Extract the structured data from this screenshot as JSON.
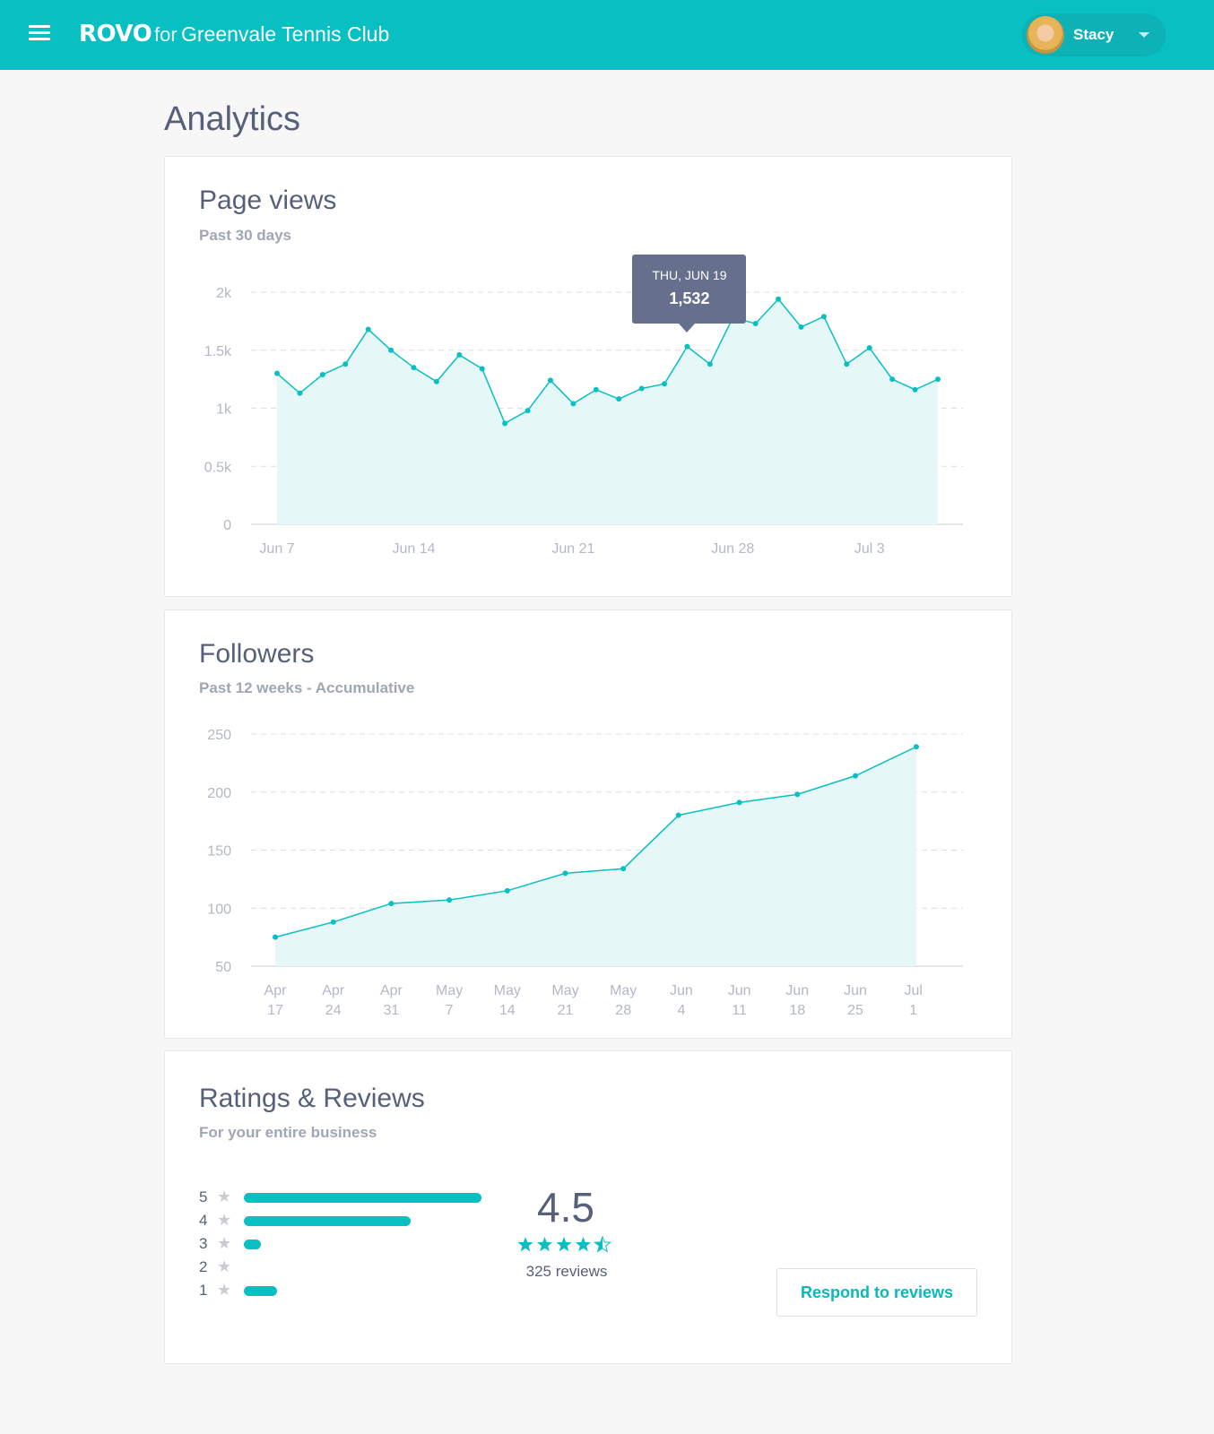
{
  "header": {
    "logo_text": "ROVO",
    "logo_for": "for",
    "organization": "Greenvale Tennis Club",
    "user_name": "Stacy",
    "menu_icon": "hamburger-menu-icon",
    "dropdown_icon": "chevron-down-icon"
  },
  "page": {
    "title": "Analytics"
  },
  "colors": {
    "accent": "#08bfc2",
    "area_fill": "#e5f7f7",
    "text": "#56607a",
    "tooltip_bg": "#66708c"
  },
  "page_views": {
    "title": "Page views",
    "subtitle": "Past 30 days",
    "tooltip": {
      "date": "THU, JUN 19",
      "value": "1,532"
    }
  },
  "followers": {
    "title": "Followers",
    "subtitle": "Past 12 weeks - Accumulative"
  },
  "reviews": {
    "title": "Ratings & Reviews",
    "subtitle": "For your entire business",
    "distribution": [
      {
        "stars": "5",
        "fraction": 1.0
      },
      {
        "stars": "4",
        "fraction": 0.7
      },
      {
        "stars": "3",
        "fraction": 0.07
      },
      {
        "stars": "2",
        "fraction": 0.0
      },
      {
        "stars": "1",
        "fraction": 0.14
      }
    ],
    "average": "4.5",
    "average_value": 4.5,
    "count_label": "325 reviews",
    "respond_label": "Respond to reviews"
  },
  "chart_data": [
    {
      "type": "area",
      "title": "Page views",
      "subtitle": "Past 30 days",
      "ylim": [
        0,
        2000
      ],
      "yticks": [
        "0",
        "0.5k",
        "1k",
        "1.5k",
        "2k"
      ],
      "ytick_values": [
        0,
        500,
        1000,
        1500,
        2000
      ],
      "xticks": [
        {
          "label": "Jun 7",
          "index": 0
        },
        {
          "label": "Jun 14",
          "index": 6
        },
        {
          "label": "Jun 21",
          "index": 13
        },
        {
          "label": "Jun 28",
          "index": 20
        },
        {
          "label": "Jul 3",
          "index": 26
        }
      ],
      "values": [
        1300,
        1130,
        1290,
        1380,
        1680,
        1500,
        1350,
        1230,
        1460,
        1340,
        870,
        980,
        1240,
        1040,
        1160,
        1080,
        1170,
        1210,
        1532,
        1380,
        1780,
        1730,
        1940,
        1700,
        1790,
        1380,
        1520,
        1250,
        1160,
        1250
      ],
      "grid": true,
      "highlight_index": 18
    },
    {
      "type": "area",
      "title": "Followers",
      "subtitle": "Past 12 weeks - Accumulative",
      "ylim": [
        50,
        250
      ],
      "yticks": [
        "50",
        "100",
        "150",
        "200",
        "250"
      ],
      "ytick_values": [
        50,
        100,
        150,
        200,
        250
      ],
      "categories": [
        [
          "Apr",
          "17"
        ],
        [
          "Apr",
          "24"
        ],
        [
          "Apr",
          "31"
        ],
        [
          "May",
          "7"
        ],
        [
          "May",
          "14"
        ],
        [
          "May",
          "21"
        ],
        [
          "May",
          "28"
        ],
        [
          "Jun",
          "4"
        ],
        [
          "Jun",
          "11"
        ],
        [
          "Jun",
          "18"
        ],
        [
          "Jun",
          "25"
        ],
        [
          "Jul",
          "1"
        ]
      ],
      "points": [
        {
          "x": 0,
          "y": 75
        },
        {
          "x": 1,
          "y": 88
        },
        {
          "x": 2,
          "y": 104
        },
        {
          "x": 3,
          "y": 107
        },
        {
          "x": 4,
          "y": 115
        },
        {
          "x": 5,
          "y": 130
        },
        {
          "x": 6,
          "y": 134
        },
        {
          "x": 6.95,
          "y": 180
        },
        {
          "x": 8,
          "y": 191
        },
        {
          "x": 9,
          "y": 198
        },
        {
          "x": 10,
          "y": 214
        },
        {
          "x": 11.05,
          "y": 239
        }
      ],
      "grid": true
    }
  ]
}
